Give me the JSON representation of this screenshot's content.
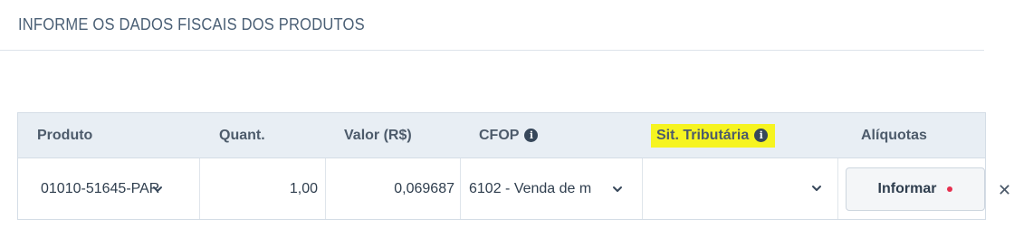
{
  "section": {
    "title": "INFORME OS DADOS FISCAIS DOS PRODUTOS"
  },
  "table": {
    "headers": {
      "produto": "Produto",
      "quant": "Quant.",
      "valor": "Valor (R$)",
      "cfop": "CFOP",
      "sit_tributaria": "Sit. Tributária",
      "aliquotas": "Alíquotas"
    },
    "row": {
      "produto": "01010-51645-PAR",
      "quant": "1,00",
      "valor": "0,069687",
      "cfop": "6102 - Venda de m",
      "sit_tributaria": "",
      "informar_label": "Informar"
    }
  },
  "colors": {
    "highlight": "#f6f420",
    "status_dot": "#e6304f",
    "header_bg": "#e8eef4"
  },
  "icons": {
    "info": "info-icon",
    "chevron": "chevron-down-icon",
    "close": "close-icon"
  }
}
